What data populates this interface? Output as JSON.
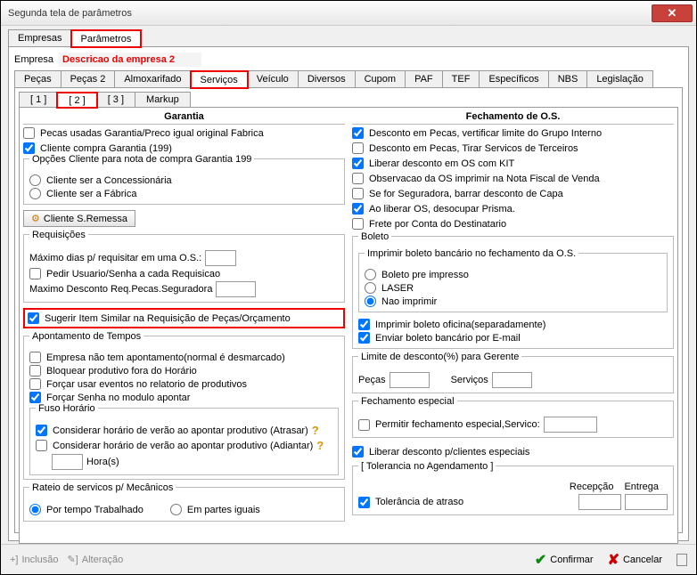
{
  "window": {
    "title": "Segunda tela de parâmetros"
  },
  "mainTabs": {
    "t0": "Empresas",
    "t1": "Parâmetros"
  },
  "empresa": {
    "label": "Empresa",
    "desc": "Descricao da empresa 2"
  },
  "innerTabs": {
    "t0": "Peças",
    "t1": "Peças 2",
    "t2": "Almoxarifado",
    "t3": "Serviços",
    "t4": "Veículo",
    "t5": "Diversos",
    "t6": "Cupom",
    "t7": "PAF",
    "t8": "TEF",
    "t9": "Específicos",
    "t10": "NBS",
    "t11": "Legislação"
  },
  "subTabs": {
    "t0": "[  1  ]",
    "t1": "[  2  ]",
    "t2": "[  3  ]",
    "t3": "Markup"
  },
  "left": {
    "garantia_title": "Garantia",
    "g1": "Pecas usadas Garantia/Preco igual original Fabrica",
    "g2": "Cliente compra Garantia (199)",
    "opt_title": "Opções Cliente para nota de compra Garantia 199",
    "o1": "Cliente ser a Concessionária",
    "o2": "Cliente ser a Fábrica",
    "btn_cliente": "Cliente S.Remessa",
    "req_title": "Requisições",
    "max_dias": "Máximo dias p/ requisitar em uma O.S.:",
    "pedir": "Pedir Usuario/Senha a cada Requisicao",
    "max_desc": "Maximo Desconto Req.Pecas.Seguradora",
    "sugerir": "Sugerir Item Similar na Requisição de Peças/Orçamento",
    "apont_title": "Apontamento de Tempos",
    "a1": "Empresa não tem apontamento(normal é desmarcado)",
    "a2": "Bloquear produtivo fora do Horário",
    "a3": "Forçar usar eventos no relatorio de produtivos",
    "a4": "Forçar Senha no modulo apontar",
    "fuso_title": "Fuso Horário",
    "f1": "Considerar horário de verão ao apontar produtivo (Atrasar)",
    "f2": "Considerar horário de verão ao apontar produtivo (Adiantar)",
    "horas": "Hora(s)",
    "rateio_title": "Rateio de servicos p/ Mecânicos",
    "r1": "Por tempo Trabalhado",
    "r2": "Em partes iguais"
  },
  "right": {
    "fech_title": "Fechamento de O.S.",
    "c1": "Desconto em Pecas, vertificar limite do Grupo Interno",
    "c2": "Desconto em Pecas, Tirar Servicos de Terceiros",
    "c3": "Liberar desconto em OS com KIT",
    "c4": "Observacao da OS imprimir na Nota Fiscal de Venda",
    "c5": "Se for Seguradora, barrar desconto de Capa",
    "c6": "Ao liberar OS, desocupar Prisma.",
    "c7": "Frete por Conta do Destinatario",
    "boleto_title": "Boleto",
    "boleto_sub": "Imprimir boleto bancário no fechamento da O.S.",
    "b1": "Boleto pre impresso",
    "b2": "LASER",
    "b3": "Nao imprimir",
    "imp_oficina": "Imprimir boleto oficina(separadamente)",
    "env_email": "Enviar boleto bancário por E-mail",
    "lim_title": "Limite de desconto(%) para Gerente",
    "pecas": "Peças",
    "servicos": "Serviços",
    "fe_title": "Fechamento especial",
    "fe1": "Permitir fechamento especial,Servico:",
    "lib": "Liberar desconto p/clientes especiais",
    "tol_title": "[ Tolerancia no Agendamento ]",
    "recep": "Recepção",
    "entrega": "Entrega",
    "tol_atraso": "Tolerância de atraso"
  },
  "footer": {
    "inclusao": "Inclusão",
    "alteracao": "Alteração",
    "confirmar": "Confirmar",
    "cancelar": "Cancelar"
  }
}
